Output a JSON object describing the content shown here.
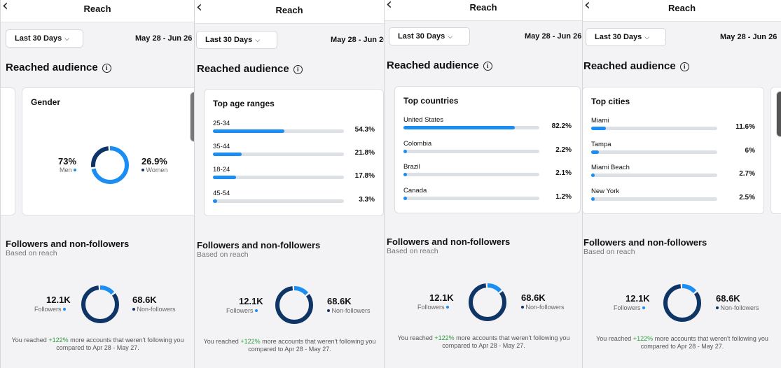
{
  "header": {
    "title": "Reach",
    "back_icon": "chevron-left-icon"
  },
  "filter": {
    "range_label": "Last 30 Days",
    "dates": "May 28 - Jun 26"
  },
  "section_title": "Reached audience",
  "gender": {
    "title": "Gender",
    "men": {
      "percent": "73%",
      "label": "Men",
      "value": 73
    },
    "women": {
      "percent": "26.9%",
      "label": "Women",
      "value": 26.9
    }
  },
  "age_ranges": {
    "title": "Top age ranges",
    "rows": [
      {
        "label": "25-34",
        "value": "54.3%",
        "fraction": 0.543
      },
      {
        "label": "35-44",
        "value": "21.8%",
        "fraction": 0.218
      },
      {
        "label": "18-24",
        "value": "17.8%",
        "fraction": 0.178
      },
      {
        "label": "45-54",
        "value": "3.3%",
        "fraction": 0.033
      }
    ]
  },
  "countries": {
    "title": "Top countries",
    "rows": [
      {
        "label": "United States",
        "value": "82.2%",
        "fraction": 0.822
      },
      {
        "label": "Colombia",
        "value": "2.2%",
        "fraction": 0.022
      },
      {
        "label": "Brazil",
        "value": "2.1%",
        "fraction": 0.021
      },
      {
        "label": "Canada",
        "value": "1.2%",
        "fraction": 0.012
      }
    ]
  },
  "cities": {
    "title": "Top cities",
    "rows": [
      {
        "label": "Miami",
        "value": "11.6%",
        "fraction": 0.116
      },
      {
        "label": "Tampa",
        "value": "6%",
        "fraction": 0.06
      },
      {
        "label": "Miami Beach",
        "value": "2.7%",
        "fraction": 0.027
      },
      {
        "label": "New York",
        "value": "2.5%",
        "fraction": 0.025
      }
    ]
  },
  "followers": {
    "title": "Followers and non-followers",
    "subtitle": "Based on reach",
    "followers_count": "12.1K",
    "followers_label": "Followers",
    "non_followers_count": "68.6K",
    "non_followers_label": "Non-followers",
    "followers_fraction": 0.15,
    "note_prefix": "You reached ",
    "note_pct": "+122%",
    "note_suffix": " more accounts that weren't following you",
    "note_line2": "compared to Apr 28 - May 27."
  },
  "colors": {
    "accent": "#1a8ef2",
    "dark": "#0f3567",
    "track": "#dde0e5",
    "positive": "#2c9b3d"
  }
}
